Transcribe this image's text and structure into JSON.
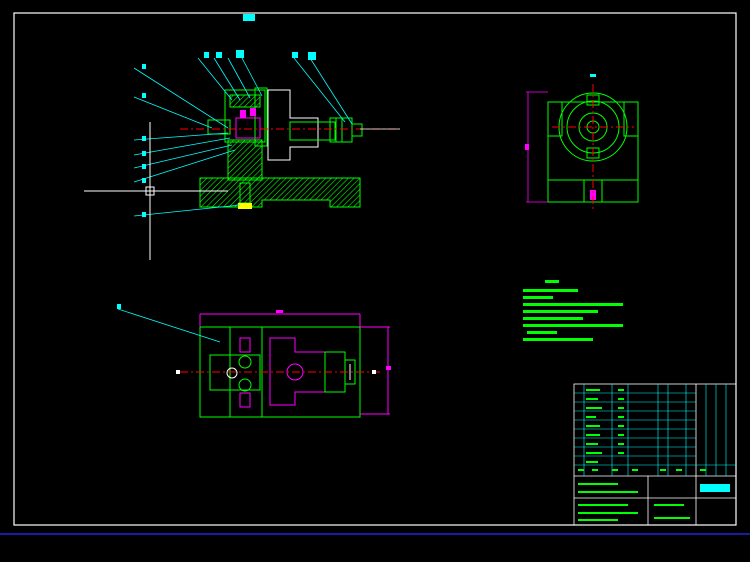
{
  "drawing": {
    "sheet_title": "",
    "title_block_name": "",
    "notes_heading": "",
    "notes_lines": [
      "",
      "",
      "",
      "",
      "",
      ""
    ]
  },
  "colors": {
    "background": "#000000",
    "frame": "#ffffff",
    "outline": "#00ff00",
    "leader": "#00ffff",
    "centerline": "#ff0000",
    "dimension": "#ff00ff",
    "hatch": "#00ff00",
    "label": "#00ffff",
    "bottom_bar": "#1a1aa8"
  },
  "icons": {
    "ucs": "crosshair-icon"
  }
}
